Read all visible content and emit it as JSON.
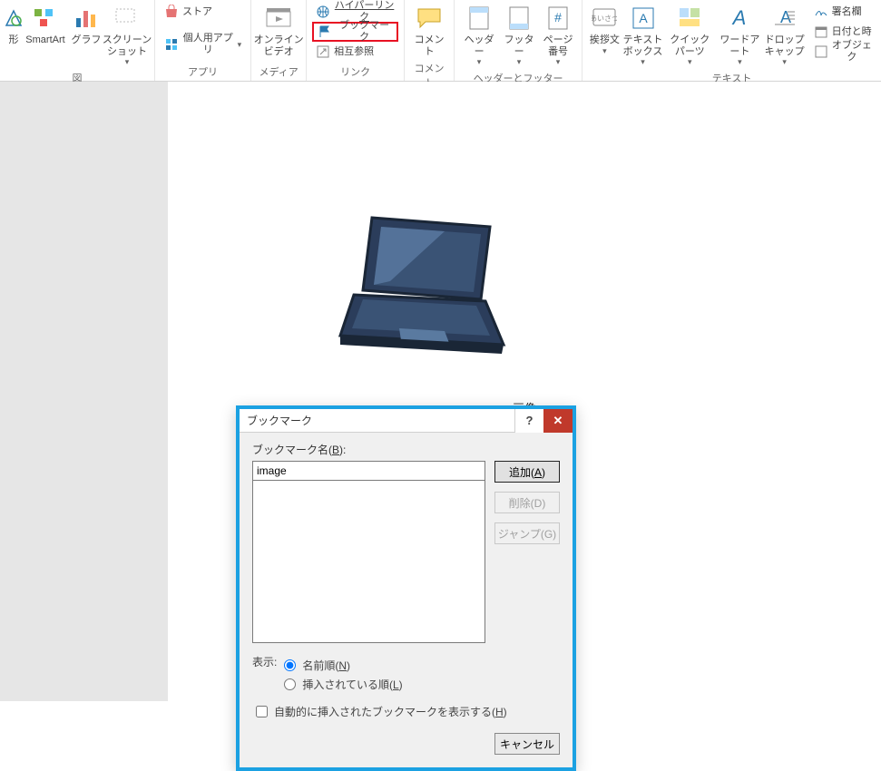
{
  "ribbon": {
    "groups": {
      "illustrations": {
        "label": "図",
        "shapes": "形",
        "smartart": "SmartArt",
        "chart": "グラフ",
        "screenshot": "スクリーン\nショット"
      },
      "apps": {
        "label": "アプリ",
        "store": "ストア",
        "my_apps": "個人用アプリ"
      },
      "media": {
        "label": "メディア",
        "online_video": "オンライン\nビデオ"
      },
      "links": {
        "label": "リンク",
        "hyperlink": "ハイパーリンク",
        "bookmark": "ブックマーク",
        "cross_ref": "相互参照"
      },
      "comments": {
        "label": "コメント",
        "comment": "コメント"
      },
      "header_footer": {
        "label": "ヘッダーとフッター",
        "header": "ヘッダー",
        "footer": "フッター",
        "page_number": "ページ\n番号"
      },
      "text": {
        "label": "テキスト",
        "greeting": "挨拶文",
        "textbox": "テキスト\nボックス",
        "quick_parts": "クイック パーツ",
        "wordart": "ワードアート",
        "dropcap": "ドロップ\nキャップ",
        "signature": "署名欄",
        "datetime": "日付と時",
        "object": "オブジェク"
      }
    }
  },
  "document": {
    "caption": "画像"
  },
  "dialog": {
    "title": "ブックマーク",
    "name_label": "ブックマーク名(B):",
    "name_value": "image",
    "buttons": {
      "add": "追加(A)",
      "delete": "削除(D)",
      "jump": "ジャンプ(G)",
      "cancel": "キャンセル"
    },
    "display_label": "表示:",
    "radio_name_order": "名前順(N)",
    "radio_insert_order": "挿入されている順(L)",
    "checkbox_auto": "自動的に挿入されたブックマークを表示する(H)"
  }
}
